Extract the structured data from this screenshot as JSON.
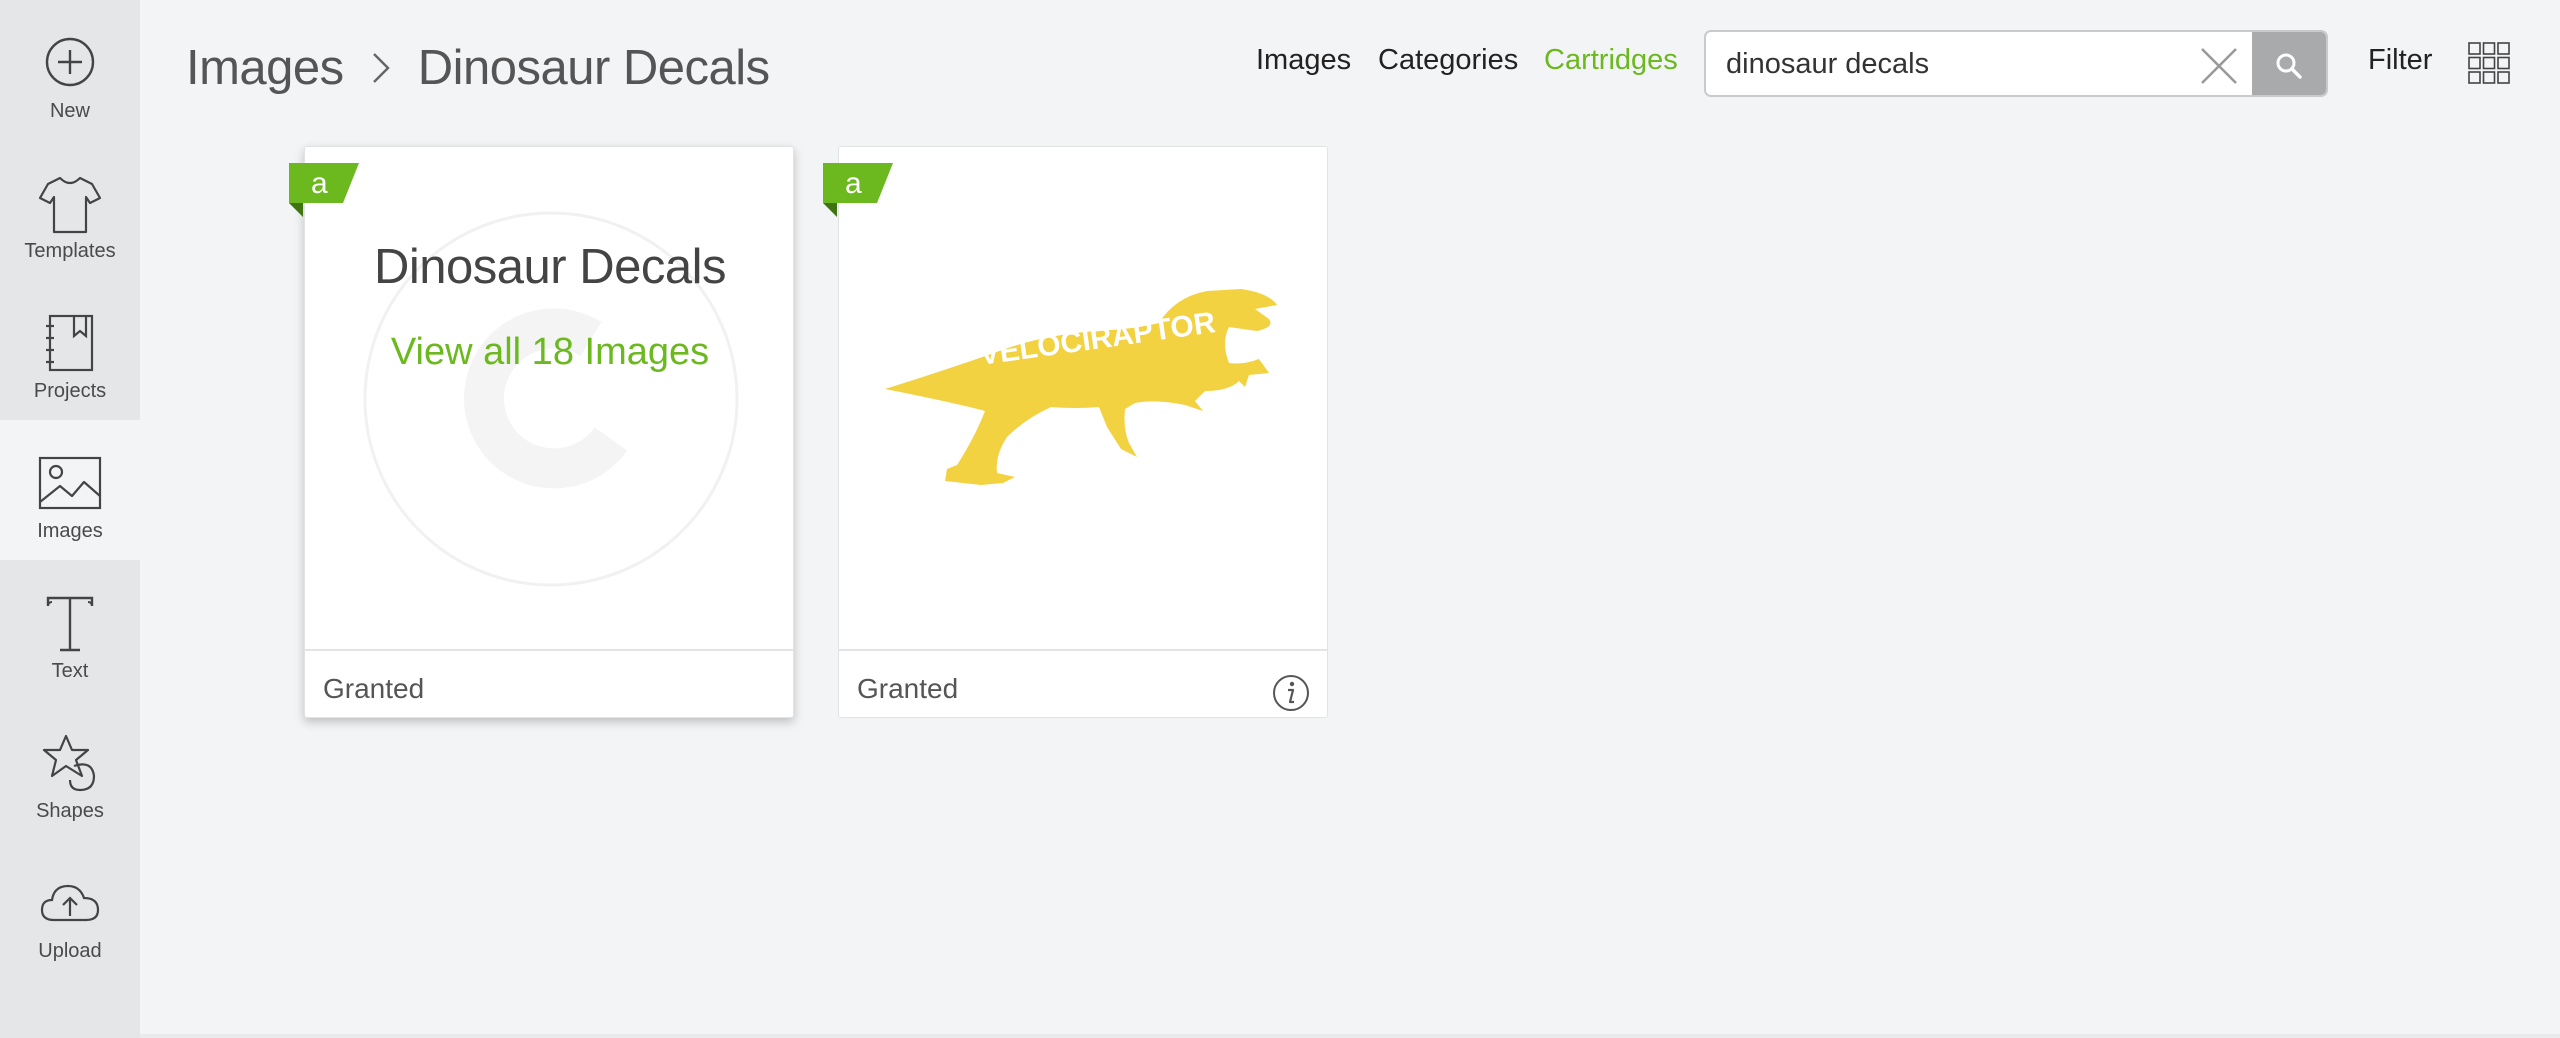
{
  "sidebar": {
    "items": [
      {
        "label": "New",
        "icon": "plus-circle-icon"
      },
      {
        "label": "Templates",
        "icon": "tshirt-icon"
      },
      {
        "label": "Projects",
        "icon": "notebook-icon"
      },
      {
        "label": "Images",
        "icon": "image-icon",
        "active": true
      },
      {
        "label": "Text",
        "icon": "text-icon"
      },
      {
        "label": "Shapes",
        "icon": "shapes-icon"
      },
      {
        "label": "Upload",
        "icon": "cloud-upload-icon"
      }
    ]
  },
  "breadcrumb": {
    "root": "Images",
    "current": "Dinosaur Decals"
  },
  "topnav": {
    "images": "Images",
    "categories": "Categories",
    "cartridges": "Cartridges"
  },
  "search": {
    "value": "dinosaur decals"
  },
  "filter_label": "Filter",
  "cards": [
    {
      "title": "Dinosaur Decals",
      "link": "View all 18 Images",
      "footer": "Granted",
      "badge": "a"
    },
    {
      "footer": "Granted",
      "badge": "a",
      "image_text": "VELOCIRAPTOR"
    }
  ],
  "colors": {
    "accent_green": "#6cb81f",
    "dino_yellow": "#f2d240",
    "sidebar_bg": "#e5e6e8"
  }
}
